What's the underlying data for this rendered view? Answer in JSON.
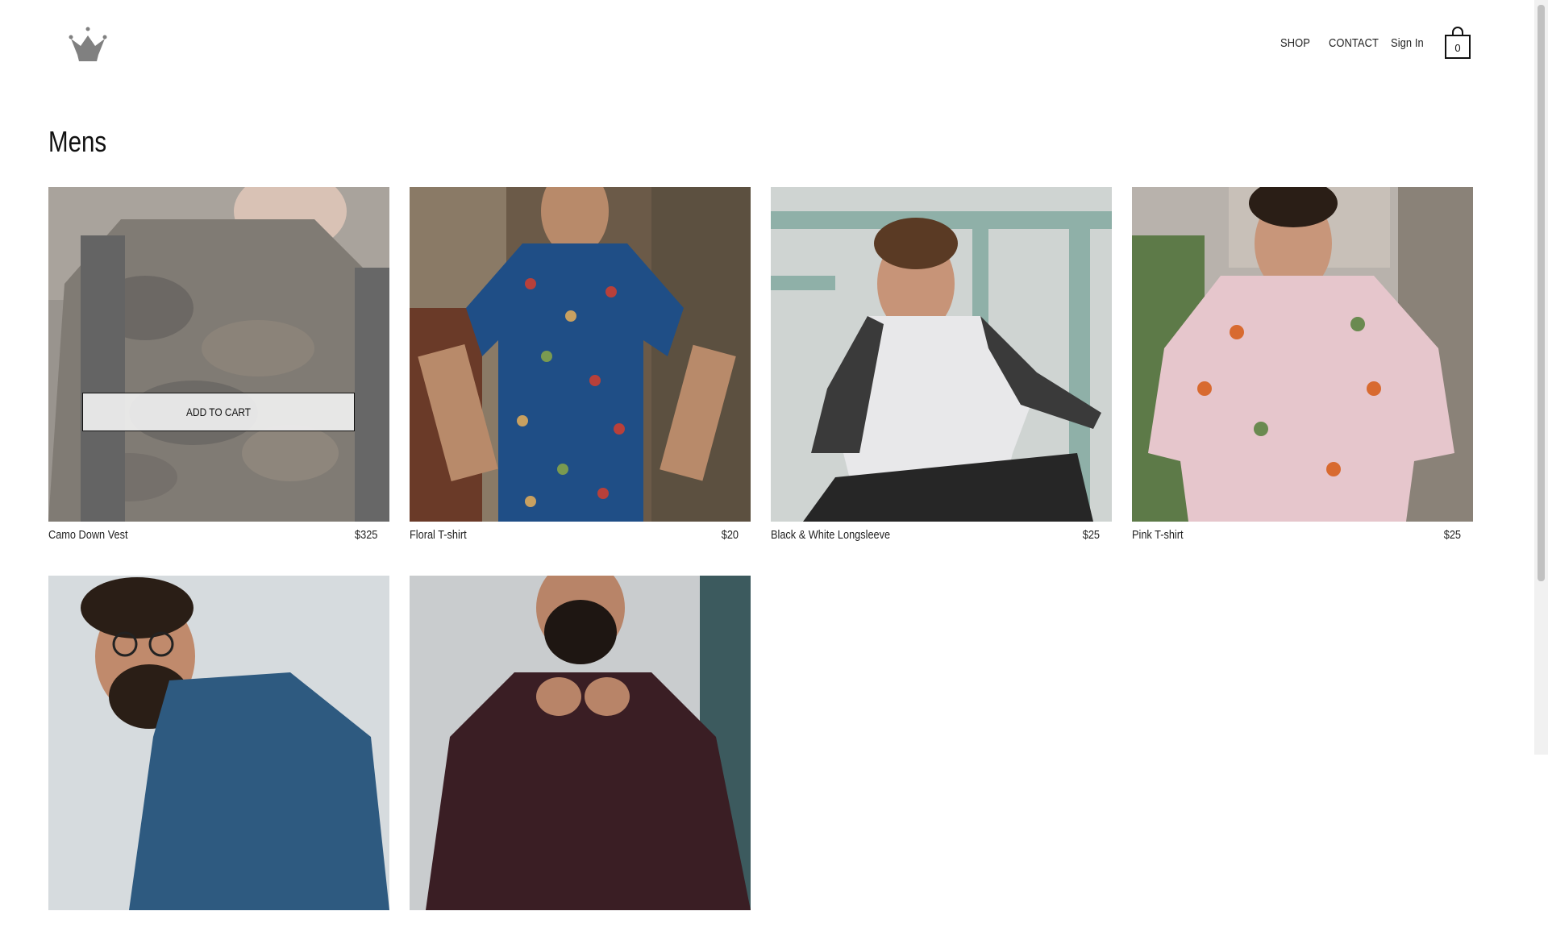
{
  "header": {
    "logo_icon": "crown-logo-icon",
    "nav": {
      "shop": "SHOP",
      "contact": "CONTACT",
      "sign_in": "Sign In"
    },
    "cart": {
      "icon": "shopping-bag-icon",
      "count": "0"
    }
  },
  "page": {
    "title": "Mens"
  },
  "products": [
    {
      "name": "Camo Down Vest",
      "price": "$325",
      "add_to_cart": "ADD TO CART"
    },
    {
      "name": "Floral T-shirt",
      "price": "$20"
    },
    {
      "name": "Black & White Longsleeve",
      "price": "$25"
    },
    {
      "name": "Pink T-shirt",
      "price": "$25"
    },
    {
      "name": "",
      "price": ""
    },
    {
      "name": "",
      "price": ""
    }
  ]
}
